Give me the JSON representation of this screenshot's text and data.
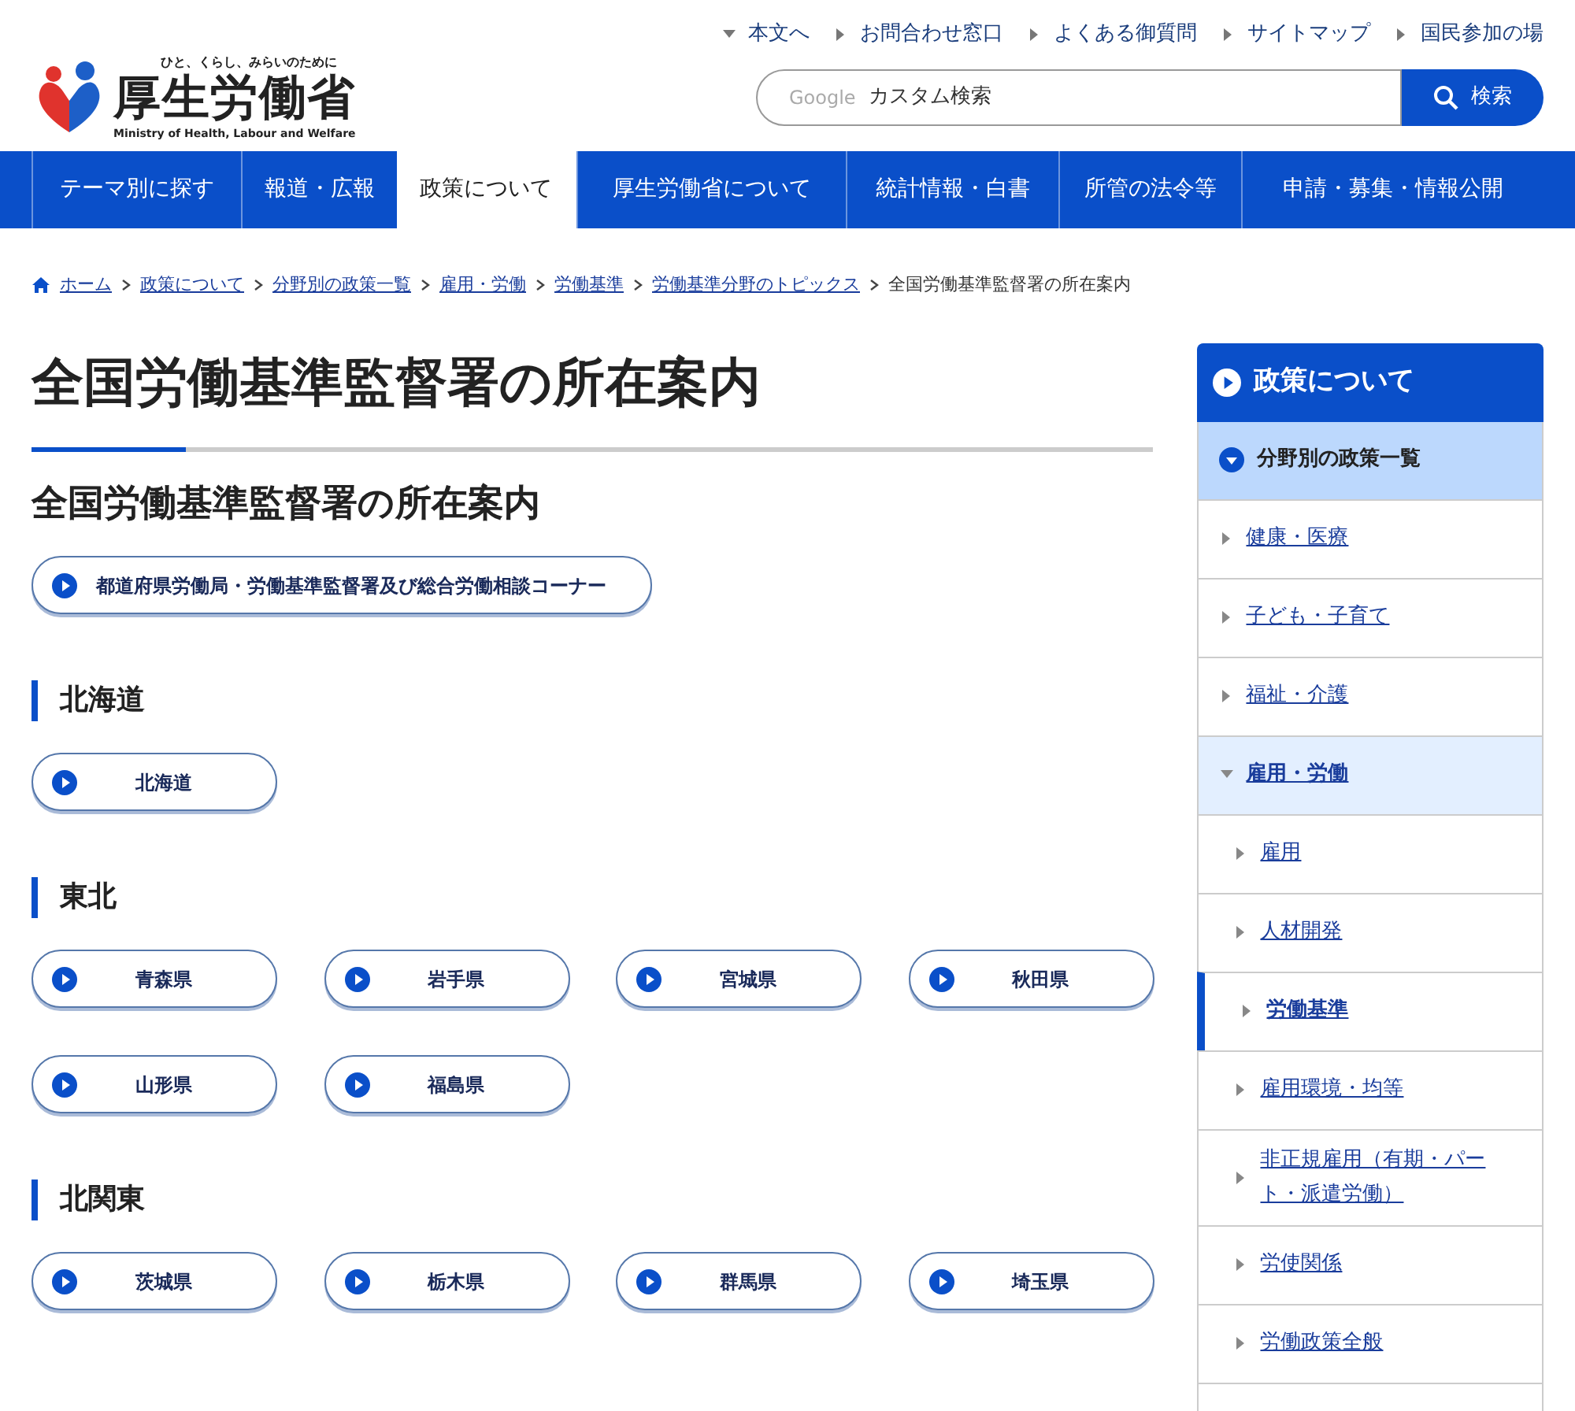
{
  "header": {
    "logo": {
      "tagline": "ひと、くらし、みらいのために",
      "name": "厚生労働省",
      "name_en": "Ministry of Health, Labour and Welfare"
    },
    "top_links": [
      {
        "label": "本文へ",
        "kind": "down"
      },
      {
        "label": "お問合わせ窓口",
        "kind": "right"
      },
      {
        "label": "よくある御質問",
        "kind": "right"
      },
      {
        "label": "サイトマップ",
        "kind": "right"
      },
      {
        "label": "国民参加の場",
        "kind": "right"
      }
    ],
    "search": {
      "brand": "Google",
      "placeholder": "カスタム検索",
      "button": "検索"
    }
  },
  "nav": [
    {
      "label": "テーマ別に探す",
      "selected": false
    },
    {
      "label": "報道・広報",
      "selected": false
    },
    {
      "label": "政策について",
      "selected": true
    },
    {
      "label": "厚生労働省について",
      "selected": false
    },
    {
      "label": "統計情報・白書",
      "selected": false
    },
    {
      "label": "所管の法令等",
      "selected": false
    },
    {
      "label": "申請・募集・情報公開",
      "selected": false
    }
  ],
  "breadcrumb": {
    "links": [
      "ホーム",
      "政策について",
      "分野別の政策一覧",
      "雇用・労働",
      "労働基準",
      "労働基準分野のトピックス"
    ],
    "current": "全国労働基準監督署の所在案内"
  },
  "main": {
    "title": "全国労働基準監督署の所在案内",
    "subtitle": "全国労働基準監督署の所在案内",
    "link_button": "都道府県労働局・労働基準監督署及び総合労働相談コーナー",
    "regions": [
      {
        "name": "北海道",
        "prefectures": [
          "北海道"
        ]
      },
      {
        "name": "東北",
        "prefectures": [
          "青森県",
          "岩手県",
          "宮城県",
          "秋田県",
          "山形県",
          "福島県"
        ]
      },
      {
        "name": "北関東",
        "prefectures": [
          "茨城県",
          "栃木県",
          "群馬県",
          "埼玉県"
        ]
      }
    ]
  },
  "sidebar": {
    "title": "政策について",
    "section": {
      "label": "分野別の政策一覧",
      "expanded": true
    },
    "items": [
      {
        "label": "健康・医療",
        "expanded": false
      },
      {
        "label": "子ども・子育て",
        "expanded": false
      },
      {
        "label": "福祉・介護",
        "expanded": false
      },
      {
        "label": "雇用・労働",
        "expanded": true,
        "children": [
          {
            "label": "雇用",
            "selected": false
          },
          {
            "label": "人材開発",
            "selected": false
          },
          {
            "label": "労働基準",
            "selected": true
          },
          {
            "label": "雇用環境・均等",
            "selected": false
          },
          {
            "label": "非正規雇用（有期・パート・派遣労働）",
            "selected": false
          },
          {
            "label": "労使関係",
            "selected": false
          },
          {
            "label": "労働政策全般",
            "selected": false
          }
        ]
      }
    ]
  }
}
